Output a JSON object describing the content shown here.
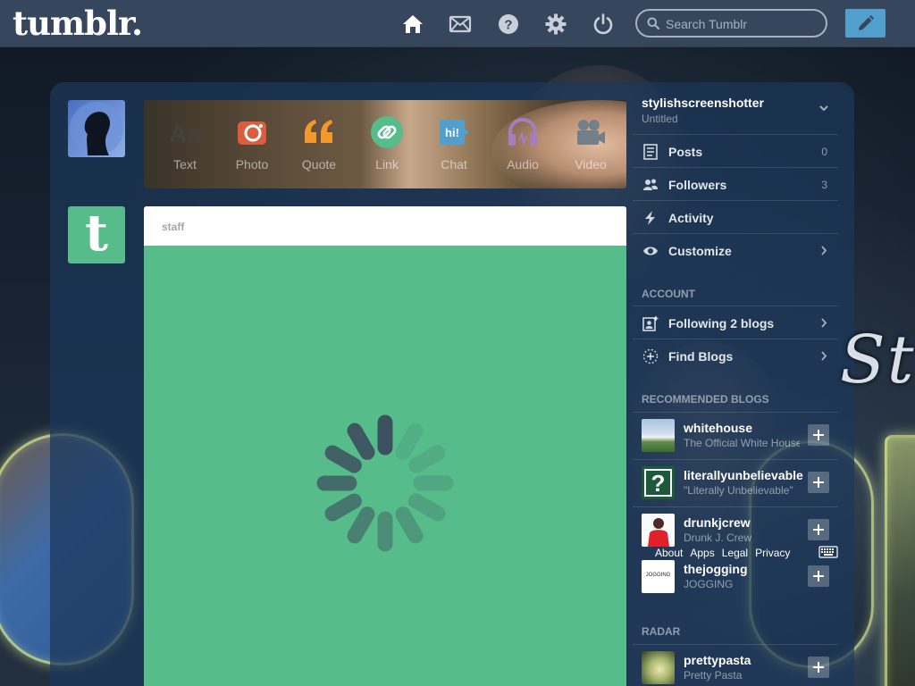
{
  "header": {
    "logo": "tumblr.",
    "nav_icons": [
      "home-icon",
      "inbox-icon",
      "help-icon",
      "settings-icon",
      "logout-icon"
    ],
    "search_placeholder": "Search Tumblr",
    "compose_icon": "pencil-icon"
  },
  "background": {
    "script_text": "St"
  },
  "post_types": [
    {
      "label": "Text",
      "icon": "text-icon",
      "glyph": "Aa",
      "color": "#444444"
    },
    {
      "label": "Photo",
      "icon": "camera-icon",
      "color": "#d95e40"
    },
    {
      "label": "Quote",
      "icon": "quote-icon",
      "glyph": "“",
      "color": "#f2992e"
    },
    {
      "label": "Link",
      "icon": "link-icon",
      "color": "#56bc8a"
    },
    {
      "label": "Chat",
      "icon": "chat-icon",
      "glyph": "hi!",
      "color": "#529ecc"
    },
    {
      "label": "Audio",
      "icon": "headphones-icon",
      "color": "#a77dc2"
    },
    {
      "label": "Video",
      "icon": "video-camera-icon",
      "color": "#748089"
    }
  ],
  "post": {
    "blog": "staff",
    "loading": true
  },
  "sidebar": {
    "blog_name": "stylishscreenshotter",
    "blog_title": "Untitled",
    "menu": [
      {
        "label": "Posts",
        "count": "0",
        "icon": "posts-icon"
      },
      {
        "label": "Followers",
        "count": "3",
        "icon": "followers-icon"
      },
      {
        "label": "Activity",
        "count": "",
        "icon": "activity-icon"
      },
      {
        "label": "Customize",
        "count": "",
        "icon": "eye-icon"
      }
    ],
    "account_title": "ACCOUNT",
    "account": [
      {
        "label": "Following 2 blogs",
        "icon": "following-icon"
      },
      {
        "label": "Find Blogs",
        "icon": "find-blogs-icon"
      }
    ],
    "recommended_title": "RECOMMENDED BLOGS",
    "recommended": [
      {
        "name": "whitehouse",
        "title": "The Official White House"
      },
      {
        "name": "literallyunbelievable",
        "title": "\"Literally Unbelievable\""
      },
      {
        "name": "drunkjcrew",
        "title": "Drunk J. Crew"
      },
      {
        "name": "thejogging",
        "title": "JOGGING",
        "avatar_text": "JOGGING"
      }
    ],
    "footer_links": [
      "About",
      "Apps",
      "Legal",
      "Privacy"
    ],
    "radar_title": "RADAR",
    "radar": [
      {
        "name": "prettypasta",
        "title": "Pretty Pasta"
      }
    ]
  },
  "colors": {
    "topbar": "#36465d",
    "accent": "#529ecc",
    "staff_green": "#56bc8a"
  }
}
